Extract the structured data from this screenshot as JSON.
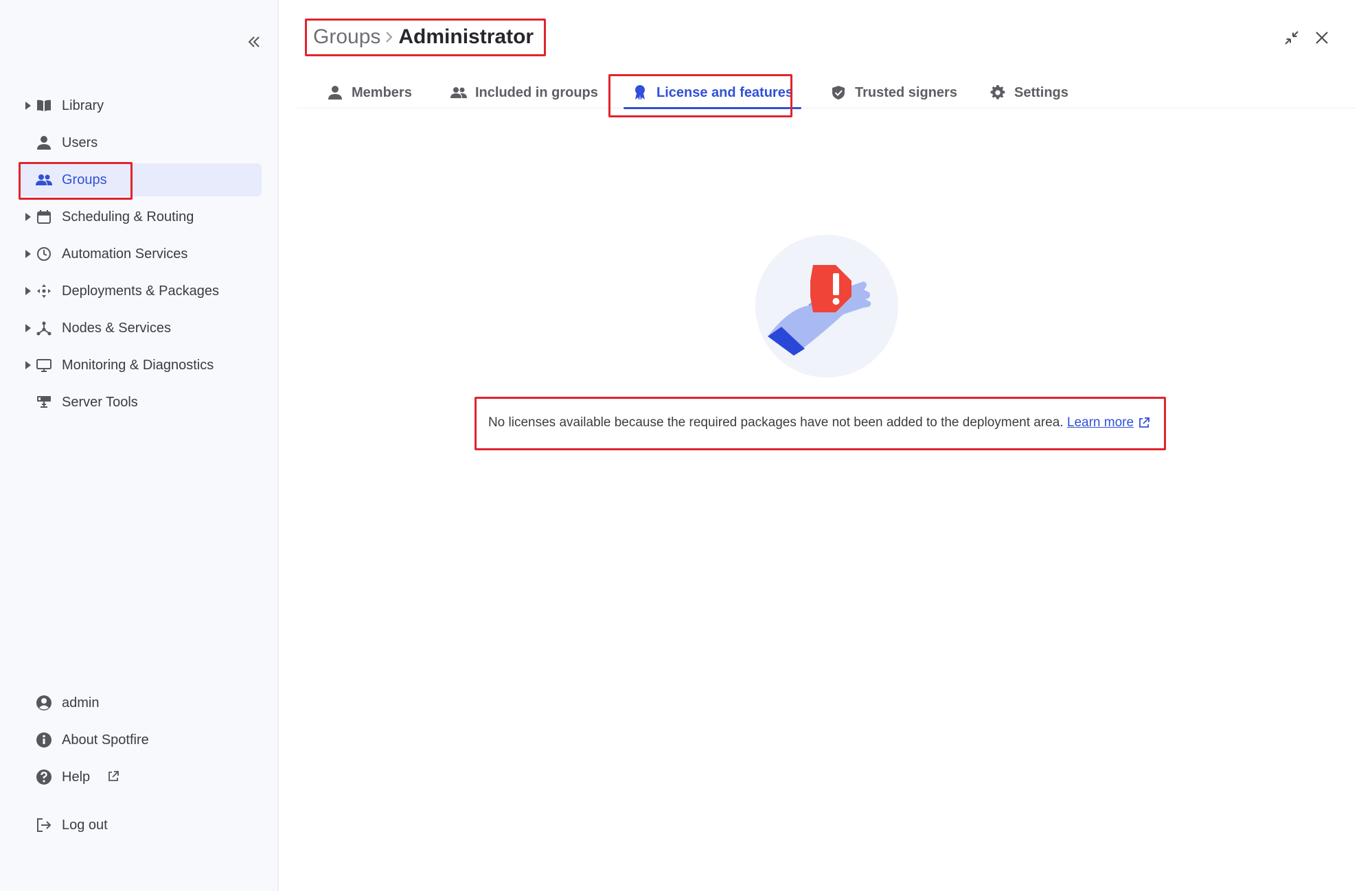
{
  "sidebar": {
    "items": [
      {
        "label": "Library",
        "has_caret": true
      },
      {
        "label": "Users",
        "has_caret": false
      },
      {
        "label": "Groups",
        "has_caret": false,
        "active": true
      },
      {
        "label": "Scheduling & Routing",
        "has_caret": true
      },
      {
        "label": "Automation Services",
        "has_caret": true
      },
      {
        "label": "Deployments & Packages",
        "has_caret": true
      },
      {
        "label": "Nodes & Services",
        "has_caret": true
      },
      {
        "label": "Monitoring & Diagnostics",
        "has_caret": true
      },
      {
        "label": "Server Tools",
        "has_caret": false
      }
    ],
    "bottom": {
      "user": "admin",
      "about": "About Spotfire",
      "help": "Help",
      "logout": "Log out"
    }
  },
  "header": {
    "breadcrumb_parent": "Groups",
    "breadcrumb_current": "Administrator"
  },
  "tabs": [
    {
      "label": "Members"
    },
    {
      "label": "Included in groups"
    },
    {
      "label": "License and features",
      "active": true
    },
    {
      "label": "Trusted signers"
    },
    {
      "label": "Settings"
    }
  ],
  "empty_state": {
    "message": "No licenses available because the required packages have not been added to the deployment area.",
    "link_label": "Learn more"
  },
  "colors": {
    "accent": "#3050d8",
    "highlight": "#e0242d",
    "sidebar_bg": "#f8f9fd",
    "active_bg": "#e8ebfc",
    "alert_red": "#f04438"
  }
}
